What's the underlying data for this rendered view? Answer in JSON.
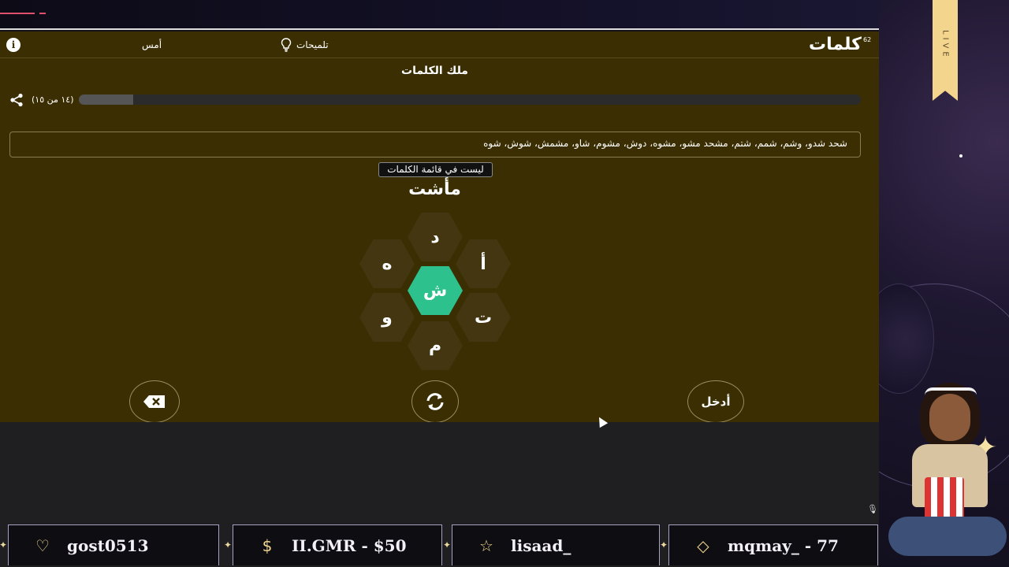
{
  "stream": {
    "live_label": "LIVE"
  },
  "game": {
    "logo": "كلمات",
    "logo_sup": "62",
    "header": {
      "info_icon": "i",
      "yesterday_label": "أمس",
      "hints_label": "تلميحات"
    },
    "level_title": "ملك الكلمات",
    "progress": {
      "count_label": "(١٤ من ١٥)",
      "fill_fraction": 0.07
    },
    "found_words": "شحد شدو، وشم، شمم، شتم، مشحد مشو، مشوه، دوش، مشوم، شاو، مشمش، شوش، شوه",
    "toast": "ليست في قائمة الكلمات",
    "current_word": "مأشت",
    "letters": {
      "center": "ش",
      "top": "د",
      "top_right": "أ",
      "bottom_right": "ت",
      "bottom": "م",
      "bottom_left": "و",
      "top_left": "ه"
    },
    "buttons": {
      "enter": "أدخل"
    }
  },
  "alerts": [
    {
      "icon": "heart-icon",
      "glyph": "♡",
      "text": "gost0513"
    },
    {
      "icon": "dollar-icon",
      "glyph": "$",
      "text": "II.GMR - $50"
    },
    {
      "icon": "star-icon",
      "glyph": "☆",
      "text": "lisaad_"
    },
    {
      "icon": "diamond-icon",
      "glyph": "◇",
      "text": "mqmay_ - 77"
    }
  ]
}
